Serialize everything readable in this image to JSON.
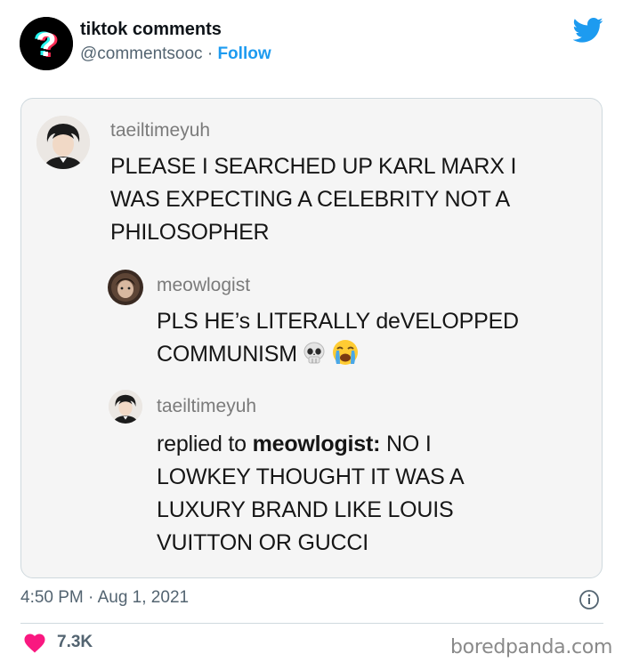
{
  "author": {
    "name": "tiktok comments",
    "handle": "@commentsooc",
    "separator": "·",
    "follow_label": "Follow"
  },
  "comments": [
    {
      "username": "taeiltimeyuh",
      "text_lines": [
        "PLEASE I SEARCHED UP KARL MARX I",
        "WAS EXPECTING A CELEBRITY NOT A",
        "PHILOSOPHER"
      ]
    },
    {
      "username": "meowlogist",
      "text_lines": [
        "PLS HE’s LITERALLY deVELOPPED",
        "COMMUNISM"
      ],
      "emojis": [
        "skull-emoji",
        "loudly-crying-emoji"
      ]
    },
    {
      "username": "taeiltimeyuh",
      "reply_prefix": "replied to",
      "reply_target": "meowlogist:",
      "text_first": "NO I",
      "text_lines": [
        "LOWKEY THOUGHT IT WAS A",
        "LUXURY BRAND LIKE LOUIS",
        "VUITTON OR GUCCI"
      ]
    }
  ],
  "footer": {
    "timestamp": "4:50 PM · Aug 1, 2021",
    "likes": "7.3K",
    "watermark": "boredpanda.com"
  },
  "colors": {
    "accent": "#1d9bf0",
    "like": "#f91880",
    "secondary_text": "#536471"
  },
  "icons": [
    "tiktok-question-logo-icon",
    "twitter-bird-icon",
    "info-icon",
    "heart-icon"
  ]
}
